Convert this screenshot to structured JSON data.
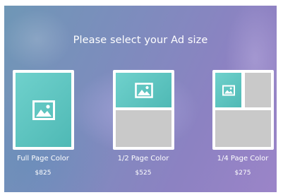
{
  "heading": "Please select your Ad size",
  "options": [
    {
      "name": "Full Page Color",
      "price": "$825",
      "icon": "image-icon"
    },
    {
      "name": "1/2 Page Color",
      "price": "$525",
      "icon": "image-icon"
    },
    {
      "name": "1/4 Page Color",
      "price": "$275",
      "icon": "image-icon"
    }
  ],
  "colors": {
    "accent_teal": "#5cc6c1",
    "empty_area_gray": "#c9c9c9",
    "card_border": "#ffffff",
    "text": "#ffffff"
  }
}
